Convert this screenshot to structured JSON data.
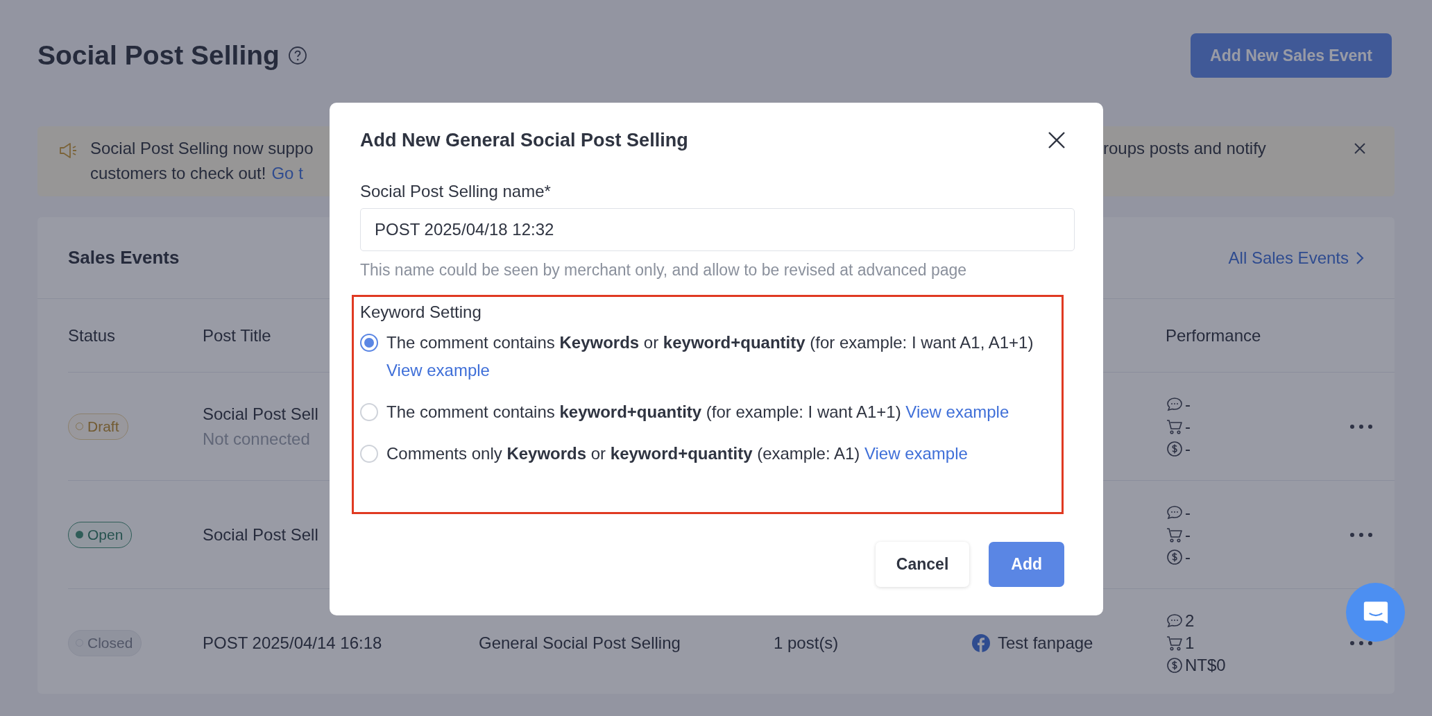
{
  "page": {
    "title": "Social Post Selling",
    "primary_button": "Add New Sales Event"
  },
  "banner": {
    "line1_left": "Social Post Selling now suppo",
    "line1_right": "roups posts and notify",
    "line2_text": "customers to check out!",
    "line2_link": "Go t"
  },
  "sales_events": {
    "title": "Sales Events",
    "link": "All Sales Events",
    "columns": [
      {
        "kind": "status",
        "label": "Status"
      },
      {
        "kind": "title",
        "label": "Post Title"
      },
      {
        "kind": "performance",
        "label": "Performance"
      }
    ],
    "rows": [
      {
        "status": {
          "label": "Draft",
          "kind": "draft"
        },
        "title": "Social Post Sell",
        "subtitle": "Not connected",
        "performance": {
          "comments": "-",
          "orders": "-",
          "sales": "-"
        }
      },
      {
        "status": {
          "label": "Open",
          "kind": "open"
        },
        "title": "Social Post Sell",
        "performance": {
          "comments": "-",
          "orders": "-",
          "sales": "-"
        }
      },
      {
        "status": {
          "label": "Closed",
          "kind": "closed"
        },
        "title": "POST 2025/04/14 16:18",
        "type": "General Social Post Selling",
        "posts": "1 post(s)",
        "channel": "Test fanpage",
        "performance": {
          "comments": "2",
          "orders": "1",
          "sales": "NT$0"
        }
      }
    ]
  },
  "modal": {
    "title": "Add New General Social Post Selling",
    "name_label": "Social Post Selling name*",
    "name_value": "POST 2025/04/18 12:32",
    "hint": "This name could be seen by merchant only, and allow to be revised at advanced page",
    "keyword_title": "Keyword Setting",
    "keyword_options": [
      {
        "text": "The comment contains **Keywords** or **keyword+quantity** (for example: I want A1, A1+1)",
        "link": "View example",
        "selected": true
      },
      {
        "text": "The comment contains **keyword+quantity** (for example: I want A1+1)",
        "link": "View example",
        "selected": false
      },
      {
        "text": "Comments only **Keywords** or **keyword+quantity** (example: A1)",
        "link": "View example",
        "selected": false
      }
    ],
    "buttons": [
      {
        "label": "Cancel",
        "kind": "secondary"
      },
      {
        "label": "Add",
        "kind": "primary"
      }
    ]
  }
}
